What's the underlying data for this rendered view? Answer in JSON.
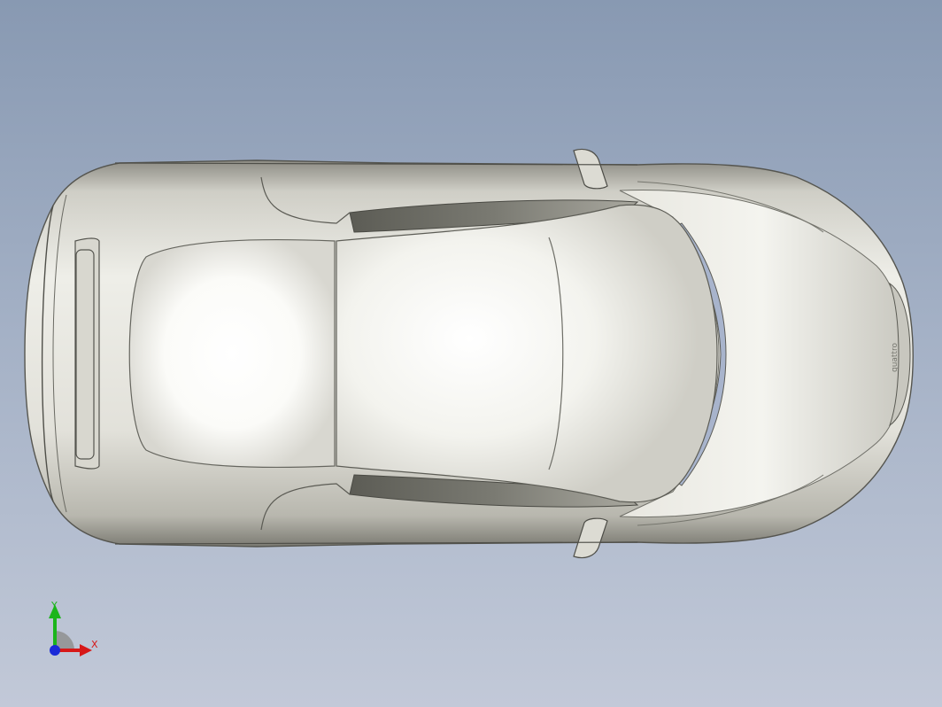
{
  "viewport": {
    "background_top": "#8899b2",
    "background_bottom": "#c2c9d8"
  },
  "model": {
    "description_icon": "car-top-view",
    "body_color": "#e4e3dc",
    "shadow_color": "#5a5a54",
    "glass_color": "#ffffff",
    "badge_text": "quattro"
  },
  "triad": {
    "y_label": "Y",
    "x_label": "X",
    "y_color": "#1bb51b",
    "x_color": "#d71818",
    "z_color": "#1a2ad8"
  }
}
